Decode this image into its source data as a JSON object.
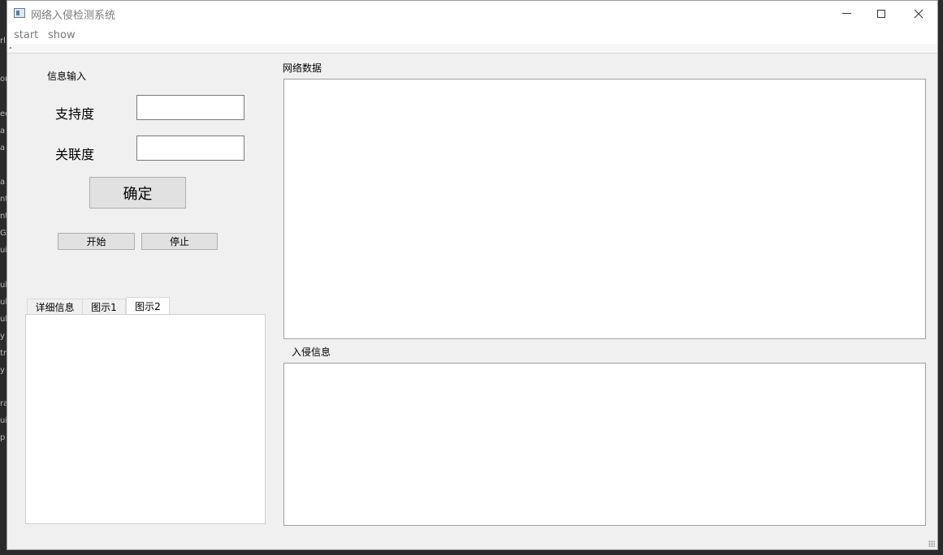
{
  "window": {
    "title": "网络入侵检测系统",
    "minimize_icon": "minimize-icon",
    "maximize_icon": "maximize-icon",
    "close_icon": "close-icon"
  },
  "menubar": {
    "items": [
      {
        "label": "start"
      },
      {
        "label": "show"
      }
    ]
  },
  "input_section": {
    "title": "信息输入",
    "support_label": "支持度",
    "support_value": "",
    "confidence_label": "关联度",
    "confidence_value": "",
    "confirm_label": "确定",
    "start_label": "开始",
    "stop_label": "停止"
  },
  "tabs": [
    {
      "label": "详细信息",
      "active": false
    },
    {
      "label": "图示1",
      "active": false
    },
    {
      "label": "图示2",
      "active": true
    }
  ],
  "network_data": {
    "title": "网络数据",
    "content": ""
  },
  "intrusion_info": {
    "title": "入侵信息",
    "content": ""
  },
  "background_fragments": [
    "rl",
    "or",
    "ec",
    "a",
    "a",
    "a",
    "nt",
    "nt",
    "G",
    "ui",
    "ul",
    "ul",
    "ul",
    "y",
    "tr",
    "y",
    "ra",
    "ui",
    "p"
  ]
}
